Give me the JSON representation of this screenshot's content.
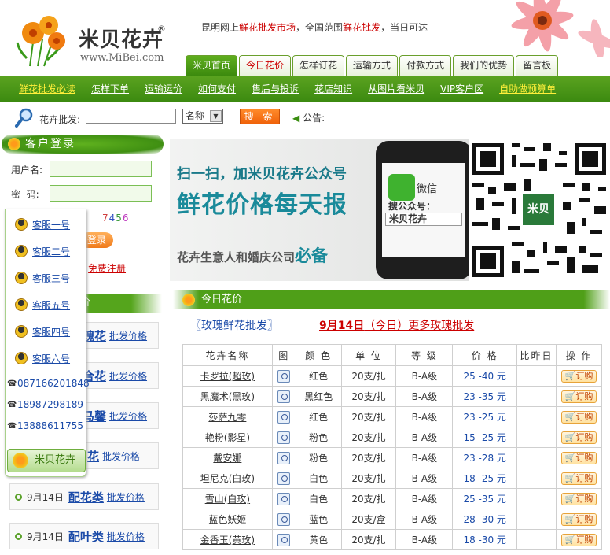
{
  "header": {
    "logo_name": "米贝花卉",
    "logo_reg": "®",
    "logo_url": "www.MiBei.com",
    "slogan_pre": "昆明网上",
    "slogan_hl1": "鲜花批发市场",
    "slogan_mid": "，全国范围",
    "slogan_hl2": "鲜花批发",
    "slogan_post": "，当日可达",
    "tabs": [
      "米贝首页",
      "今日花价",
      "怎样订花",
      "运输方式",
      "付款方式",
      "我们的优势",
      "留言板"
    ]
  },
  "subnav": [
    "鲜花批发必读",
    "怎样下单",
    "运输运价",
    "如何支付",
    "售后与投诉",
    "花店知识",
    "从图片看米贝",
    "VIP客户区",
    "自助做预算单"
  ],
  "search": {
    "label": "花卉批发:",
    "value": "",
    "select_value": "名称",
    "button": "搜 索",
    "notice": "公告:"
  },
  "login": {
    "title": "客户登录",
    "username_label": "用户名:",
    "password_label": "密  码:",
    "captcha": "7456",
    "login_button": "登录",
    "register": "免费注册"
  },
  "kefu": {
    "items": [
      "客服一号",
      "客服二号",
      "客服三号",
      "客服五号",
      "客服四号",
      "客服六号"
    ],
    "phones": [
      "087166201848",
      "18987298189",
      "13888611755"
    ],
    "logo": "米贝花卉"
  },
  "left_price": {
    "title": "价",
    "categories": [
      {
        "date": "",
        "name": "瑰花",
        "text": "批发价格"
      },
      {
        "date": "",
        "name": "合花",
        "text": "批发价格"
      },
      {
        "date": "",
        "name": "马馨",
        "text": "批发价格"
      },
      {
        "date": "",
        "name": "花",
        "text": "批发价格"
      },
      {
        "date": "9月14日",
        "name": "配花类",
        "text": "批发价格"
      },
      {
        "date": "9月14日",
        "name": "配叶类",
        "text": "批发价格"
      }
    ]
  },
  "banner": {
    "line1": "扫一扫，加米贝花卉公众号",
    "line2": "鲜花价格每天报",
    "line3": "花卉生意人和婚庆公司",
    "line3b": "必备",
    "wx_label": "微信",
    "search_pub": "搜公众号：",
    "pub_name": "米贝花卉",
    "qr_logo": "米贝"
  },
  "today": {
    "title": "今日花价",
    "rose_title": "〖玫瑰鲜花批发〗",
    "rose_more_date": "9月14日",
    "rose_more_text": "（今日）更多玫瑰批发",
    "columns": [
      "花卉名称",
      "图",
      "颜 色",
      "单 位",
      "等 级",
      "价 格",
      "比昨日",
      "操 作"
    ],
    "order_label": "订购",
    "rows": [
      {
        "name": "卡罗拉(超玫)",
        "color": "红色",
        "unit": "20支/扎",
        "grade": "B-A级",
        "price": "25 -40 元",
        "compare": ""
      },
      {
        "name": "黑魔术(黑玫)",
        "color": "黑红色",
        "unit": "20支/扎",
        "grade": "B-A级",
        "price": "23 -35 元",
        "compare": ""
      },
      {
        "name": "莎萨九零",
        "color": "红色",
        "unit": "20支/扎",
        "grade": "B-A级",
        "price": "23 -25 元",
        "compare": ""
      },
      {
        "name": "艳粉(影星)",
        "color": "粉色",
        "unit": "20支/扎",
        "grade": "B-A级",
        "price": "15 -25 元",
        "compare": ""
      },
      {
        "name": "戴安娜",
        "color": "粉色",
        "unit": "20支/扎",
        "grade": "B-A级",
        "price": "23 -28 元",
        "compare": ""
      },
      {
        "name": "坦尼克(白玫)",
        "color": "白色",
        "unit": "20支/扎",
        "grade": "B-A级",
        "price": "18 -25 元",
        "compare": ""
      },
      {
        "name": "雪山(白玫)",
        "color": "白色",
        "unit": "20支/扎",
        "grade": "B-A级",
        "price": "25 -35 元",
        "compare": ""
      },
      {
        "name": "蓝色妖姬",
        "color": "蓝色",
        "unit": "20支/盒",
        "grade": "B-A级",
        "price": "28 -30 元",
        "compare": ""
      },
      {
        "name": "金香玉(黄玫)",
        "color": "黄色",
        "unit": "20支/扎",
        "grade": "B-A级",
        "price": "18 -30 元",
        "compare": ""
      }
    ]
  }
}
